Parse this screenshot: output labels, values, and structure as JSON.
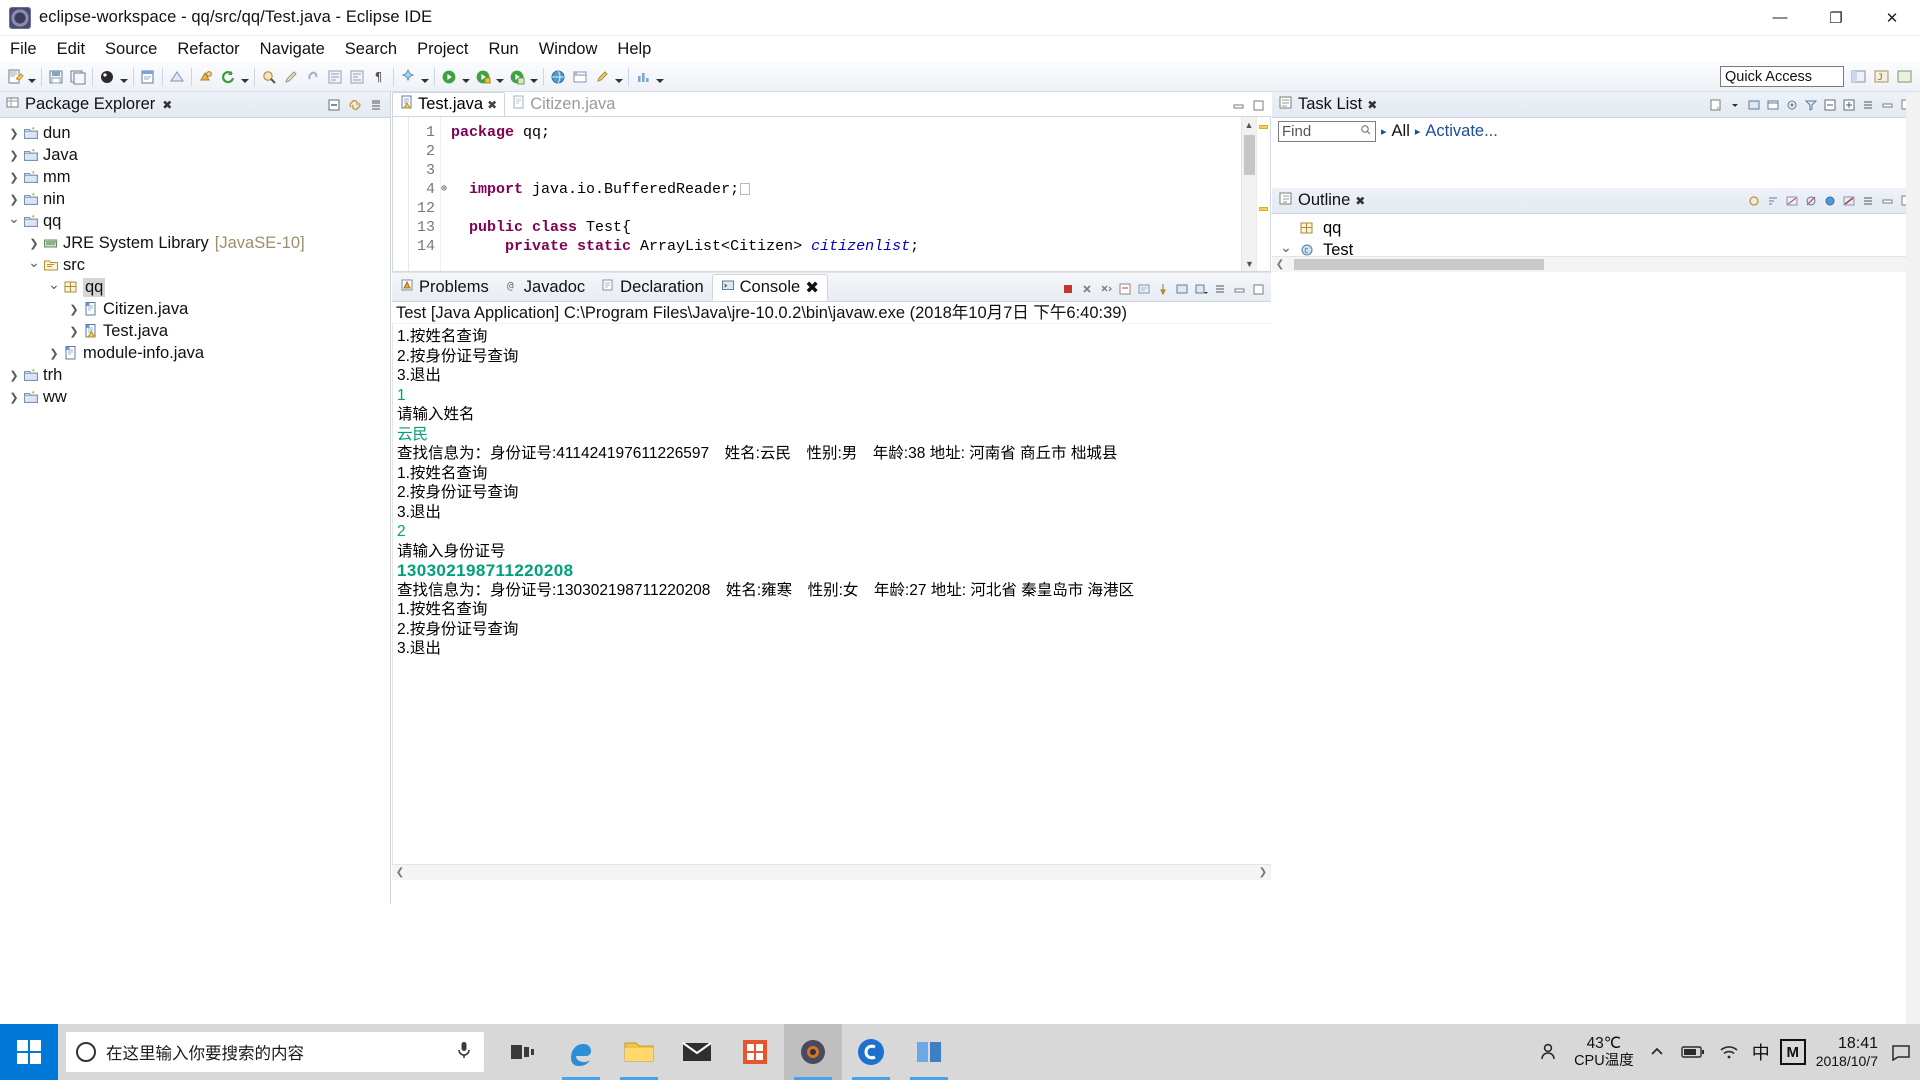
{
  "window": {
    "title": "eclipse-workspace - qq/src/qq/Test.java - Eclipse IDE",
    "minimize": "—",
    "maximize": "❐",
    "close": "✕"
  },
  "menu": [
    {
      "label": "File"
    },
    {
      "label": "Edit"
    },
    {
      "label": "Source"
    },
    {
      "label": "Refactor"
    },
    {
      "label": "Navigate"
    },
    {
      "label": "Search"
    },
    {
      "label": "Project"
    },
    {
      "label": "Run"
    },
    {
      "label": "Window"
    },
    {
      "label": "Help"
    }
  ],
  "toolbar": {
    "quick_access_placeholder": "Quick Access"
  },
  "package_explorer": {
    "title": "Package Explorer",
    "close": "✖",
    "tree": [
      {
        "indent": 0,
        "twist": "❯",
        "icon": "project-icon",
        "label": "dun",
        "selected": false,
        "dim": ""
      },
      {
        "indent": 0,
        "twist": "❯",
        "icon": "project-icon",
        "label": "Java",
        "selected": false,
        "dim": ""
      },
      {
        "indent": 0,
        "twist": "❯",
        "icon": "project-icon",
        "label": "mm",
        "selected": false,
        "dim": ""
      },
      {
        "indent": 0,
        "twist": "❯",
        "icon": "project-icon",
        "label": "nin",
        "selected": false,
        "dim": ""
      },
      {
        "indent": 0,
        "twist": "⌄",
        "icon": "project-open-icon",
        "label": "qq",
        "selected": false,
        "dim": ""
      },
      {
        "indent": 1,
        "twist": "❯",
        "icon": "library-icon",
        "label": "JRE System Library",
        "selected": false,
        "dim": "[JavaSE-10]"
      },
      {
        "indent": 1,
        "twist": "⌄",
        "icon": "source-folder-icon",
        "label": "src",
        "selected": false,
        "dim": ""
      },
      {
        "indent": 2,
        "twist": "⌄",
        "icon": "package-icon",
        "label": "qq",
        "selected": true,
        "dim": ""
      },
      {
        "indent": 3,
        "twist": "❯",
        "icon": "java-file-icon",
        "label": "Citizen.java",
        "selected": false,
        "dim": ""
      },
      {
        "indent": 3,
        "twist": "❯",
        "icon": "java-file-warn-icon",
        "label": "Test.java",
        "selected": false,
        "dim": ""
      },
      {
        "indent": 2,
        "twist": "❯",
        "icon": "java-file-icon",
        "label": "module-info.java",
        "selected": false,
        "dim": ""
      },
      {
        "indent": 0,
        "twist": "❯",
        "icon": "project-icon",
        "label": "trh",
        "selected": false,
        "dim": ""
      },
      {
        "indent": 0,
        "twist": "❯",
        "icon": "project-icon",
        "label": "ww",
        "selected": false,
        "dim": ""
      }
    ]
  },
  "editor": {
    "tabs": [
      {
        "label": "Test.java",
        "active": true,
        "close": "✖"
      },
      {
        "label": "Citizen.java",
        "active": false,
        "close": ""
      }
    ],
    "lines": [
      {
        "num": "1",
        "fold": false,
        "segments": [
          {
            "t": "package",
            "c": "kw"
          },
          {
            "t": " qq;",
            "c": ""
          }
        ]
      },
      {
        "num": "2",
        "fold": false,
        "segments": [
          {
            "t": "",
            "c": ""
          }
        ]
      },
      {
        "num": "3",
        "fold": false,
        "segments": [
          {
            "t": "",
            "c": ""
          }
        ]
      },
      {
        "num": "4",
        "fold": true,
        "segments": [
          {
            "t": "  ",
            "c": ""
          },
          {
            "t": "import",
            "c": "kw"
          },
          {
            "t": " java.io.BufferedReader;",
            "c": ""
          },
          {
            "t": "□",
            "c": "box"
          }
        ]
      },
      {
        "num": "12",
        "fold": false,
        "segments": [
          {
            "t": "",
            "c": ""
          }
        ]
      },
      {
        "num": "13",
        "fold": false,
        "segments": [
          {
            "t": "  ",
            "c": ""
          },
          {
            "t": "public class",
            "c": "kw"
          },
          {
            "t": " Test{",
            "c": ""
          }
        ]
      },
      {
        "num": "14",
        "fold": false,
        "segments": [
          {
            "t": "      ",
            "c": ""
          },
          {
            "t": "private static",
            "c": "kw"
          },
          {
            "t": " ArrayList<Citizen> ",
            "c": ""
          },
          {
            "t": "citizenlist",
            "c": "fld"
          },
          {
            "t": ";",
            "c": ""
          }
        ]
      }
    ]
  },
  "console": {
    "tabs": [
      {
        "label": "Problems",
        "icon": "problems-icon",
        "active": false,
        "close": ""
      },
      {
        "label": "Javadoc",
        "icon": "javadoc-icon",
        "active": false,
        "close": ""
      },
      {
        "label": "Declaration",
        "icon": "declaration-icon",
        "active": false,
        "close": ""
      },
      {
        "label": "Console",
        "icon": "console-icon",
        "active": true,
        "close": "✖"
      }
    ],
    "header": "Test [Java Application] C:\\Program Files\\Java\\jre-10.0.2\\bin\\javaw.exe (2018年10月7日 下午6:40:39)",
    "output": [
      {
        "text": "1.按姓名查询",
        "kind": "out"
      },
      {
        "text": "2.按身份证号查询",
        "kind": "out"
      },
      {
        "text": "3.退出",
        "kind": "out"
      },
      {
        "text": "1",
        "kind": "in"
      },
      {
        "text": "请输入姓名",
        "kind": "out"
      },
      {
        "text": "云民",
        "kind": "in"
      },
      {
        "text": "查找信息为：身份证号:411424197611226597　姓名:云民　性别:男　年龄:38 地址: 河南省 商丘市 柮城县",
        "kind": "out"
      },
      {
        "text": "1.按姓名查询",
        "kind": "out"
      },
      {
        "text": "2.按身份证号查询",
        "kind": "out"
      },
      {
        "text": "3.退出",
        "kind": "out"
      },
      {
        "text": "2",
        "kind": "in"
      },
      {
        "text": "请输入身份证号",
        "kind": "out"
      },
      {
        "text": "130302198711220208",
        "kind": "in-big"
      },
      {
        "text": "查找信息为：身份证号:130302198711220208　姓名:雍寒　性别:女　年龄:27 地址: 河北省 秦皇岛市 海港区",
        "kind": "out"
      },
      {
        "text": "1.按姓名查询",
        "kind": "out"
      },
      {
        "text": "2.按身份证号查询",
        "kind": "out"
      },
      {
        "text": "3.退出",
        "kind": "out"
      }
    ]
  },
  "task_list": {
    "title": "Task List",
    "close": "✖",
    "find_placeholder": "Find",
    "all_label": "All",
    "activate_label": "Activate..."
  },
  "outline": {
    "title": "Outline",
    "close": "✖",
    "items": [
      {
        "twist": "",
        "icon": "package-icon",
        "label": "qq"
      },
      {
        "twist": "⌄",
        "icon": "class-icon",
        "label": "Test"
      }
    ]
  },
  "taskbar": {
    "search_placeholder": "在这里输入你要搜索的内容",
    "cpu_temp": "43℃",
    "cpu_label": "CPU温度",
    "time": "18:41",
    "date": "2018/10/7",
    "ime": "中",
    "mlogo": "M"
  }
}
